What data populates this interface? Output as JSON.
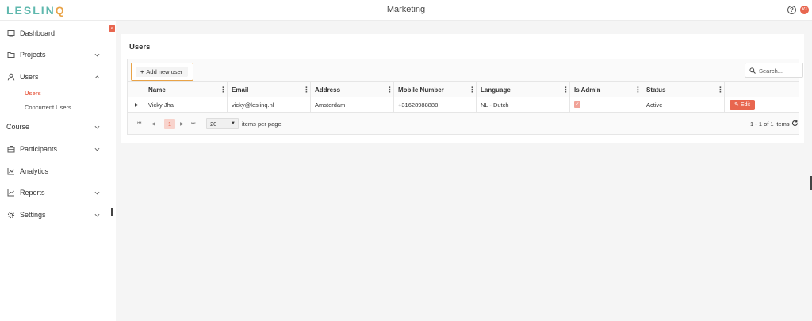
{
  "header": {
    "logo_main": "LESLIN",
    "logo_accent": "Q",
    "title": "Marketing",
    "help_symbol": "?",
    "avatar_initials": "VJ"
  },
  "sidebar": {
    "items": [
      {
        "label": "Dashboard",
        "icon": "dashboard-icon"
      },
      {
        "label": "Projects",
        "icon": "folder-icon",
        "chevron": "down"
      },
      {
        "label": "Users",
        "icon": "user-icon",
        "chevron": "up"
      },
      {
        "label": "Course",
        "chevron": "down"
      },
      {
        "label": "Participants",
        "icon": "participants-icon",
        "chevron": "down"
      },
      {
        "label": "Analytics",
        "icon": "analytics-icon"
      },
      {
        "label": "Reports",
        "icon": "reports-icon",
        "chevron": "down"
      },
      {
        "label": "Settings",
        "icon": "gear-icon",
        "chevron": "down"
      }
    ],
    "users_sub": [
      {
        "label": "Users",
        "active": true
      },
      {
        "label": "Concurrent Users",
        "active": false
      }
    ],
    "collapse_symbol": "«"
  },
  "page": {
    "title": "Users"
  },
  "toolbar": {
    "add_label": "Add new user",
    "search_placeholder": "Search..."
  },
  "table": {
    "columns": [
      "Name",
      "Email",
      "Address",
      "Mobile Number",
      "Language",
      "Is Admin",
      "Status"
    ],
    "rows": [
      {
        "name": "Vicky Jha",
        "email": "vicky@leslinq.nl",
        "address": "Amsterdam",
        "mobile": "+31628988888",
        "language": "NL - Dutch",
        "is_admin": true,
        "status": "Active",
        "action": "Edit"
      }
    ]
  },
  "pager": {
    "current_page": "1",
    "per_page": "20",
    "per_page_label": "items per page",
    "range": "1 - 1 of 1 items"
  },
  "colors": {
    "accent": "#e8664f",
    "logo_teal": "#5fb8ae",
    "logo_orange": "#e9a347",
    "highlight_border": "#e9a347"
  }
}
